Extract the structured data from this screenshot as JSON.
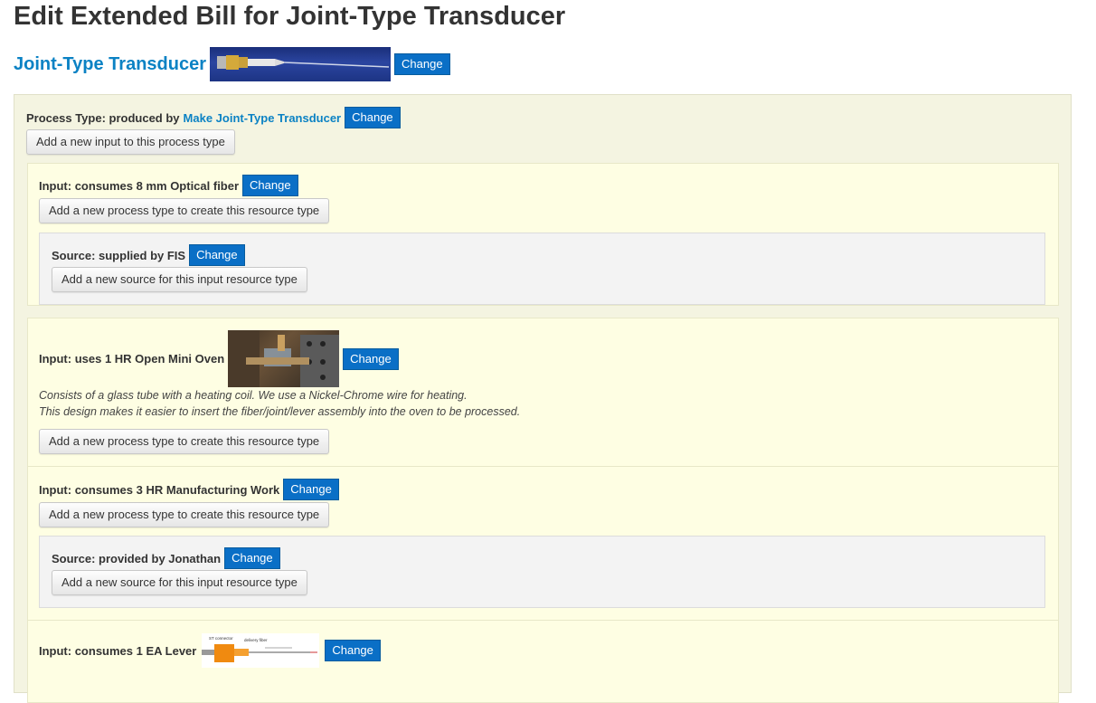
{
  "page": {
    "title": "Edit Extended Bill for Joint-Type Transducer"
  },
  "resource": {
    "name": "Joint-Type Transducer",
    "change_label": "Change"
  },
  "process": {
    "prefix": "Process Type: produced by",
    "name": "Make Joint-Type Transducer",
    "change_label": "Change",
    "add_input_label": "Add a new input to this process type"
  },
  "inputs": [
    {
      "label": "Input: consumes 8 mm Optical fiber",
      "change_label": "Change",
      "add_process_label": "Add a new process type to create this resource type",
      "source": {
        "label": "Source: supplied by FIS",
        "change_label": "Change",
        "add_source_label": "Add a new source for this input resource type"
      }
    },
    {
      "label": "Input: uses 1 HR Open Mini Oven",
      "change_label": "Change",
      "description_lines": [
        "Consists of a glass tube with a heating coil. We use a Nickel-Chrome wire for heating.",
        "This design makes it easier to insert the fiber/joint/lever assembly into the oven to be processed."
      ],
      "add_process_label": "Add a new process type to create this resource type"
    },
    {
      "label": "Input: consumes 3 HR Manufacturing Work",
      "change_label": "Change",
      "add_process_label": "Add a new process type to create this resource type",
      "source": {
        "label": "Source: provided by Jonathan",
        "change_label": "Change",
        "add_source_label": "Add a new source for this input resource type"
      }
    },
    {
      "label": "Input: consumes 1 EA Lever",
      "change_label": "Change",
      "diagram_labels": [
        "ST connector",
        "delivery fiber"
      ]
    }
  ]
}
